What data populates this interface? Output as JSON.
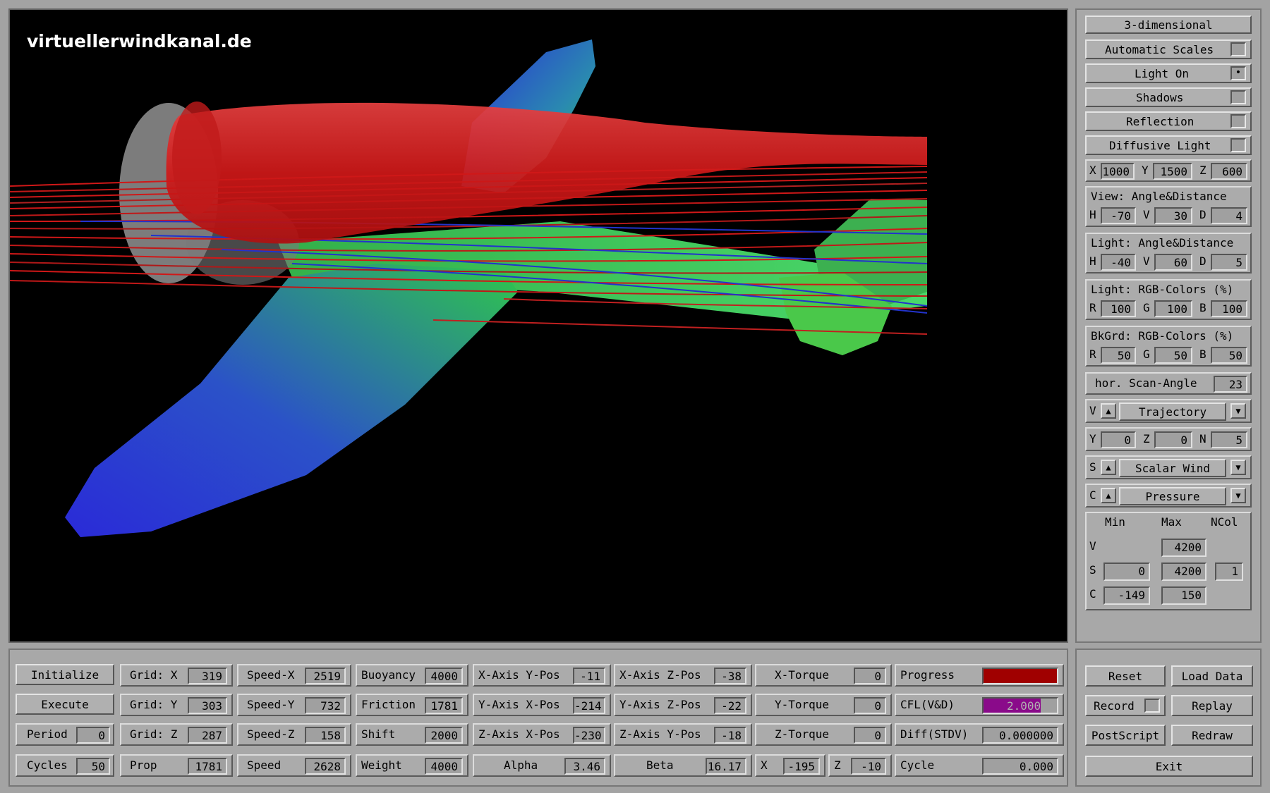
{
  "watermark": "virtuellerwindkanal.de",
  "right": {
    "mode": "3-dimensional",
    "auto_scales": "Automatic Scales",
    "light_on": "Light On",
    "light_on_checked": "•",
    "shadows": "Shadows",
    "reflection": "Reflection",
    "diffusive": "Diffusive Light",
    "xyz": {
      "x_l": "X",
      "x": "1000",
      "y_l": "Y",
      "y": "1500",
      "z_l": "Z",
      "z": "600"
    },
    "view": {
      "title": "View:  Angle&Distance",
      "h_l": "H",
      "h": "-70",
      "v_l": "V",
      "v": "30",
      "d_l": "D",
      "d": "4"
    },
    "light": {
      "title": "Light: Angle&Distance",
      "h_l": "H",
      "h": "-40",
      "v_l": "V",
      "v": "60",
      "d_l": "D",
      "d": "5"
    },
    "light_rgb": {
      "title": "Light: RGB-Colors (%)",
      "r_l": "R",
      "r": "100",
      "g_l": "G",
      "g": "100",
      "b_l": "B",
      "b": "100"
    },
    "bk_rgb": {
      "title": "BkGrd: RGB-Colors (%)",
      "r_l": "R",
      "r": "50",
      "g_l": "G",
      "g": "50",
      "b_l": "B",
      "b": "50"
    },
    "scan": {
      "label": "hor. Scan-Angle",
      "value": "23"
    },
    "v_sel": {
      "prefix": "V",
      "value": "Trajectory"
    },
    "yzn": {
      "y_l": "Y",
      "y": "0",
      "z_l": "Z",
      "z": "0",
      "n_l": "N",
      "n": "5"
    },
    "s_sel": {
      "prefix": "S",
      "value": "Scalar Wind"
    },
    "c_sel": {
      "prefix": "C",
      "value": "Pressure"
    },
    "scales": {
      "min": "Min",
      "max": "Max",
      "ncol": "NCol",
      "v_l": "V",
      "v_max": "4200",
      "s_l": "S",
      "s_min": "0",
      "s_max": "4200",
      "s_ncol": "1",
      "c_l": "C",
      "c_min": "-149",
      "c_max": "150"
    }
  },
  "bottom": {
    "initialize": "Initialize",
    "execute": "Execute",
    "period_l": "Period",
    "period": "0",
    "cycles_l": "Cycles",
    "cycles": "50",
    "gridx_l": "Grid: X",
    "gridx": "319",
    "gridy_l": "Grid: Y",
    "gridy": "303",
    "gridz_l": "Grid: Z",
    "gridz": "287",
    "prop_l": "Prop",
    "prop": "1781",
    "speedx_l": "Speed-X",
    "speedx": "2519",
    "speedy_l": "Speed-Y",
    "speedy": "732",
    "speedz_l": "Speed-Z",
    "speedz": "158",
    "speed_l": "Speed",
    "speed": "2628",
    "buoy_l": "Buoyancy",
    "buoy": "4000",
    "fric_l": "Friction",
    "fric": "1781",
    "shift_l": "Shift",
    "shift": "2000",
    "weight_l": "Weight",
    "weight": "4000",
    "xay_l": "X-Axis Y-Pos",
    "xay": "-11",
    "yax_l": "Y-Axis X-Pos",
    "yax": "-214",
    "zax_l": "Z-Axis X-Pos",
    "zax": "-230",
    "alpha_l": "Alpha",
    "alpha": "3.46",
    "xaz_l": "X-Axis Z-Pos",
    "xaz": "-38",
    "yaz_l": "Y-Axis Z-Pos",
    "yaz": "-22",
    "zay_l": "Z-Axis Y-Pos",
    "zay": "-18",
    "beta_l": "Beta",
    "beta": "16.17",
    "xt_l": "X-Torque",
    "xt": "0",
    "yt_l": "Y-Torque",
    "yt": "0",
    "zt_l": "Z-Torque",
    "zt": "0",
    "x_l": "X",
    "x": "-195",
    "z_l": "Z",
    "z": "-10",
    "progress_l": "Progress",
    "cfl_l": "CFL(V&D)",
    "cfl": "2.000",
    "diff_l": "Diff(STDV)",
    "diff": "0.000000",
    "cycle_l": "Cycle",
    "cycle": "0.000",
    "progress_color": "#a00000",
    "cfl_color": "#8a0a8a"
  },
  "actions": {
    "reset": "Reset",
    "load": "Load Data",
    "record": "Record",
    "replay": "Replay",
    "postscript": "PostScript",
    "redraw": "Redraw",
    "exit": "Exit"
  }
}
